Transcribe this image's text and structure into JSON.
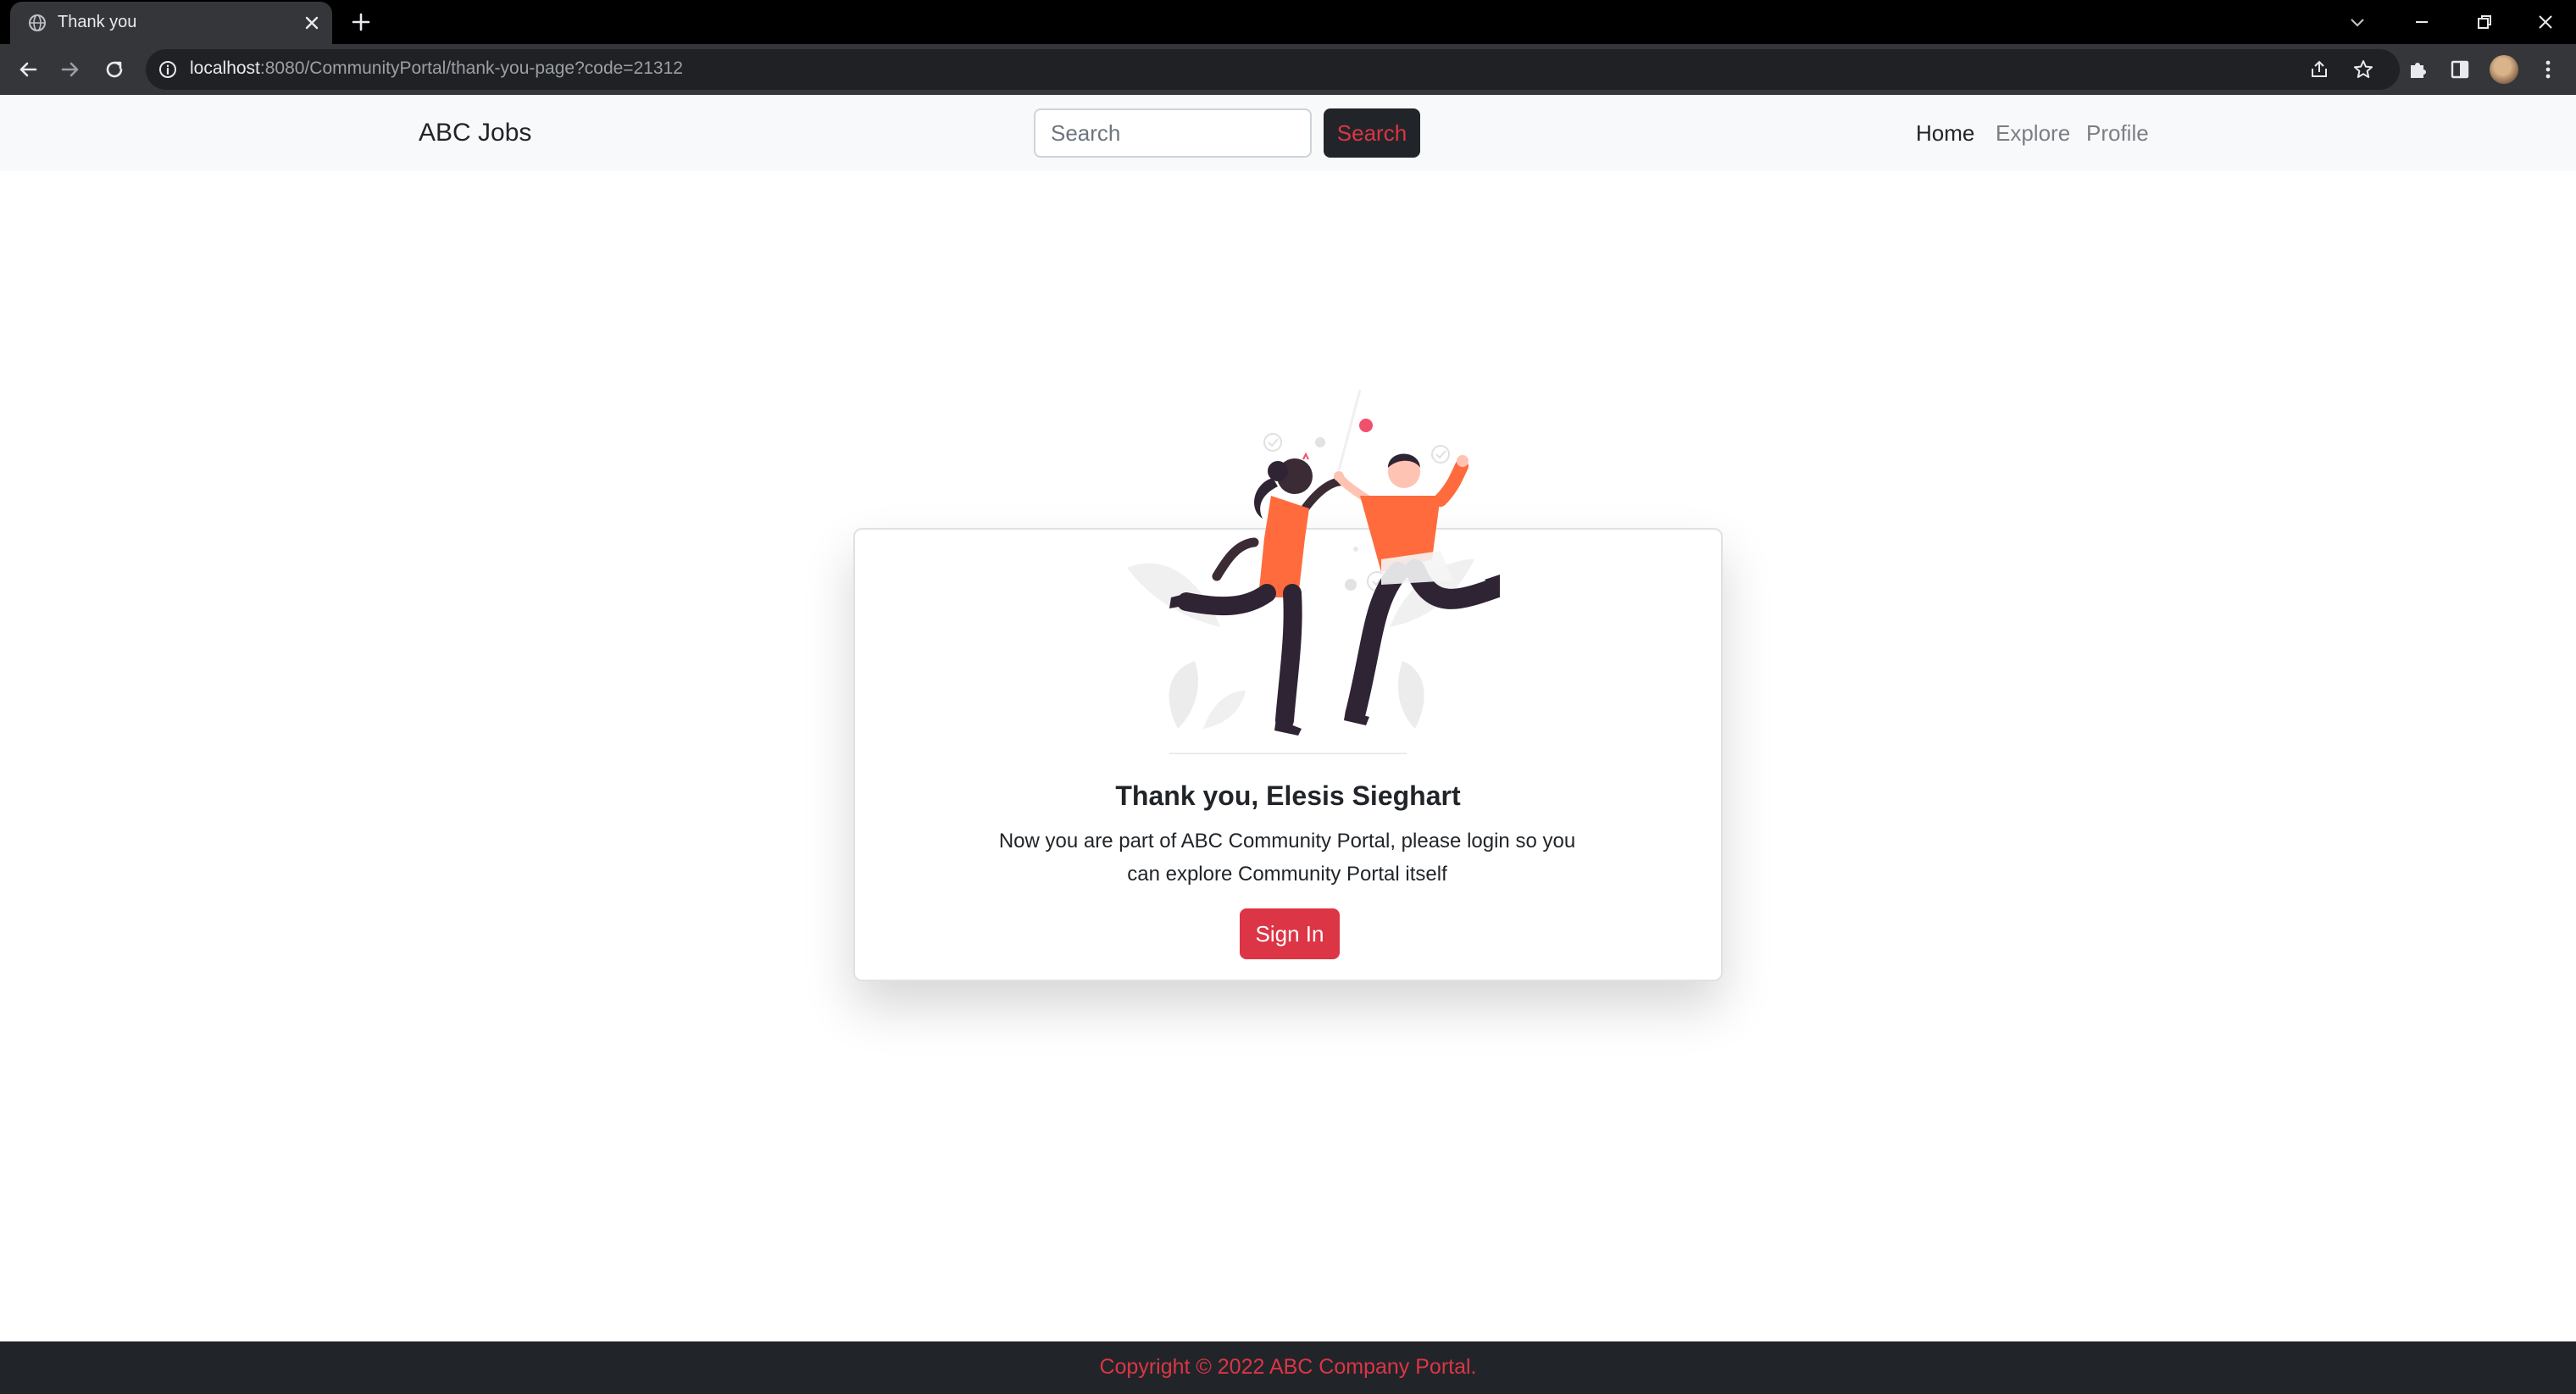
{
  "browser": {
    "tab_title": "Thank you",
    "url_host": "localhost",
    "url_rest": ":8080/CommunityPortal/thank-you-page?code=21312"
  },
  "navbar": {
    "brand": "ABC Jobs",
    "search_placeholder": "Search",
    "search_button": "Search",
    "links": [
      "Home",
      "Explore",
      "Profile"
    ]
  },
  "card": {
    "title": "Thank you, Elesis Sieghart",
    "message": "Now you are part of ABC Community Portal, please login so you can explore Community Portal itself",
    "button": "Sign In"
  },
  "footer": {
    "text": "Copyright © 2022 ABC Company Portal."
  },
  "colors": {
    "brand_red": "#dc3545",
    "dark": "#212529",
    "illustration_orange": "#ff6b3d"
  },
  "icons": [
    "globe-icon",
    "close-icon",
    "plus-icon",
    "chevron-down-icon",
    "minimize-icon",
    "restore-icon",
    "window-close-icon",
    "back-arrow-icon",
    "forward-arrow-icon",
    "reload-icon",
    "info-icon",
    "share-icon",
    "star-icon",
    "puzzle-icon",
    "sidepanel-icon",
    "avatar",
    "kebab-menu-icon"
  ]
}
